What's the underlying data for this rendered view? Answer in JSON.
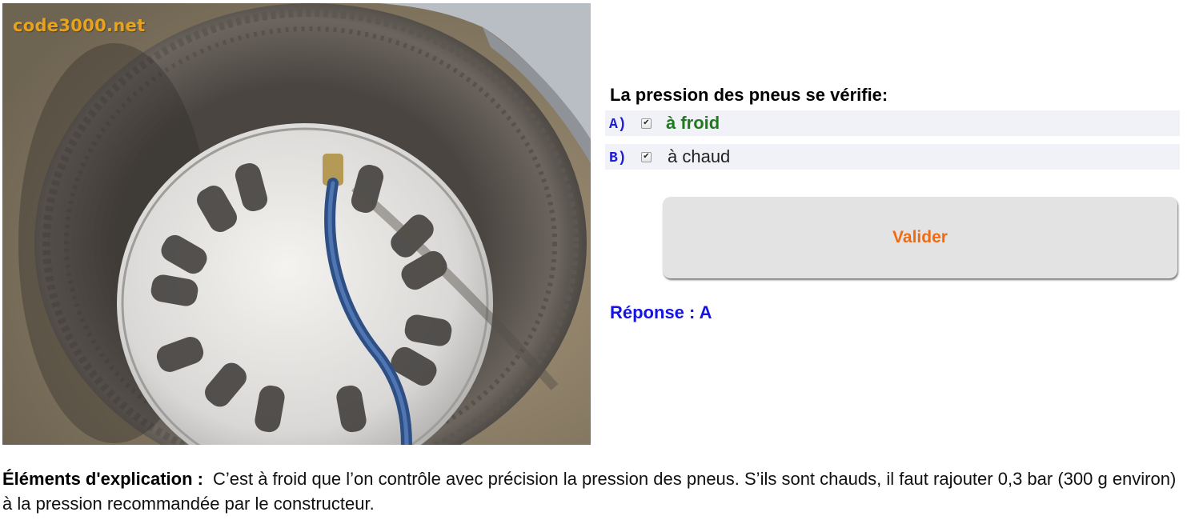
{
  "photo": {
    "watermark": "code3000.net",
    "description_icon": "tyre-pressure-photo"
  },
  "question": {
    "text": "La pression des pneus se vérifie:",
    "options": [
      {
        "letter": "A)",
        "label": "à froid",
        "checked": true,
        "correct": true
      },
      {
        "letter": "B)",
        "label": "à chaud",
        "checked": true,
        "correct": false
      }
    ]
  },
  "actions": {
    "validate_label": "Valider"
  },
  "answer": {
    "text": "Réponse : A"
  },
  "explanation": {
    "label": "Éléments d'explication :",
    "text": "C’est à froid que l’on contrôle avec précision la pression des pneus. S’ils sont chauds, il faut rajouter 0,3 bar (300 g environ) à la pression recommandée par le constructeur."
  },
  "colors": {
    "option_letter": "#1d1dd6",
    "correct_option": "#207a1e",
    "answer": "#1414e6",
    "button_text": "#f26a10",
    "button_bg": "#e3e3e3",
    "option_bg": "#f1f2f7",
    "watermark": "#e8a21c"
  }
}
